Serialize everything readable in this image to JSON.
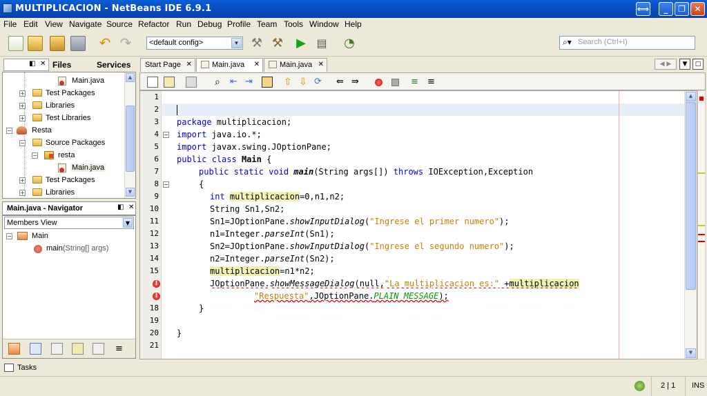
{
  "window": {
    "title": "MULTIPLICACION - NetBeans IDE 6.9.1",
    "restore_label": "⟺",
    "min_label": "_",
    "max_label": "❐",
    "close_label": "✕"
  },
  "menu": [
    "File",
    "Edit",
    "View",
    "Navigate",
    "Source",
    "Refactor",
    "Run",
    "Debug",
    "Profile",
    "Team",
    "Tools",
    "Window",
    "Help"
  ],
  "toolbar": {
    "config": "<default config>",
    "search_placeholder": "Search (Ctrl+I)"
  },
  "projects_panel": {
    "tabs": [
      "Files",
      "Services"
    ],
    "items": [
      {
        "label": "Main.java",
        "type": "java"
      },
      {
        "label": "Test Packages",
        "type": "folder"
      },
      {
        "label": "Libraries",
        "type": "folder"
      },
      {
        "label": "Test Libraries",
        "type": "folder"
      },
      {
        "label": "Resta",
        "type": "project"
      },
      {
        "label": "Source Packages",
        "type": "folder"
      },
      {
        "label": "resta",
        "type": "package"
      },
      {
        "label": "Main.java",
        "type": "java"
      },
      {
        "label": "Test Packages",
        "type": "folder"
      },
      {
        "label": "Libraries",
        "type": "folder"
      }
    ]
  },
  "navigator": {
    "title": "Main.java - Navigator",
    "view": "Members View",
    "class_name": "Main",
    "method": "main",
    "method_sig": "(String[] args)"
  },
  "editor": {
    "tabs": [
      {
        "label": "Start Page",
        "active": false
      },
      {
        "label": "Main.java",
        "active": true
      },
      {
        "label": "Main.java",
        "active": false
      }
    ],
    "line_numbers": [
      "1",
      "2",
      "3",
      "4",
      "5",
      "6",
      "7",
      "8",
      "9",
      "10",
      "11",
      "12",
      "13",
      "14",
      "15",
      "",
      "",
      "18",
      "19",
      "20",
      "21"
    ],
    "code": {
      "l3a": "package",
      "l3b": " multiplicacion;",
      "l4a": "import",
      "l4b": " java.io.*;",
      "l5a": "import",
      "l5b": " javax.swing.JOptionPane;",
      "l6a": "public class",
      "l6b": "Main",
      "l6c": " {",
      "l7a": "public static void",
      "l7b": "main",
      "l7c": "(String args[]) ",
      "l7d": "throws",
      "l7e": " IOException,Exception",
      "l8": "{",
      "l9a": "int",
      "l9b": "multiplicacion",
      "l9c": "=0,n1,n2;",
      "l10": "String Sn1,Sn2;",
      "l11a": "Sn1=JOptionPane.",
      "l11b": "showInputDialog",
      "l11c": "(",
      "l11d": "\"Ingrese el primer numero\"",
      "l11e": ");",
      "l12a": "n1=Integer.",
      "l12b": "parseInt",
      "l12c": "(Sn1);",
      "l13a": "Sn2=JOptionPane.",
      "l13b": "showInputDialog",
      "l13c": "(",
      "l13d": "\"Ingrese el segundo numero\"",
      "l13e": ");",
      "l14a": "n2=Integer.",
      "l14b": "parseInt",
      "l14c": "(Sn2);",
      "l15a": "multiplicacion",
      "l15b": "=n1*n2;",
      "l16a": "JOptionPane.",
      "l16b": "showMessageDialog",
      "l16c": "(null,",
      "l16d": "\"La multiplicacion es:\"",
      "l16e": " +",
      "l16f": "multiplicacion",
      "l17a": "\"Respuesta\"",
      "l17b": ",JOptionPane.",
      "l17c": "PLAIN_MESSAGE",
      "l17d": ");",
      "l18": "}",
      "l20": "}"
    }
  },
  "status": {
    "tasks": "Tasks",
    "position": "2 | 1",
    "mode": "INS"
  }
}
